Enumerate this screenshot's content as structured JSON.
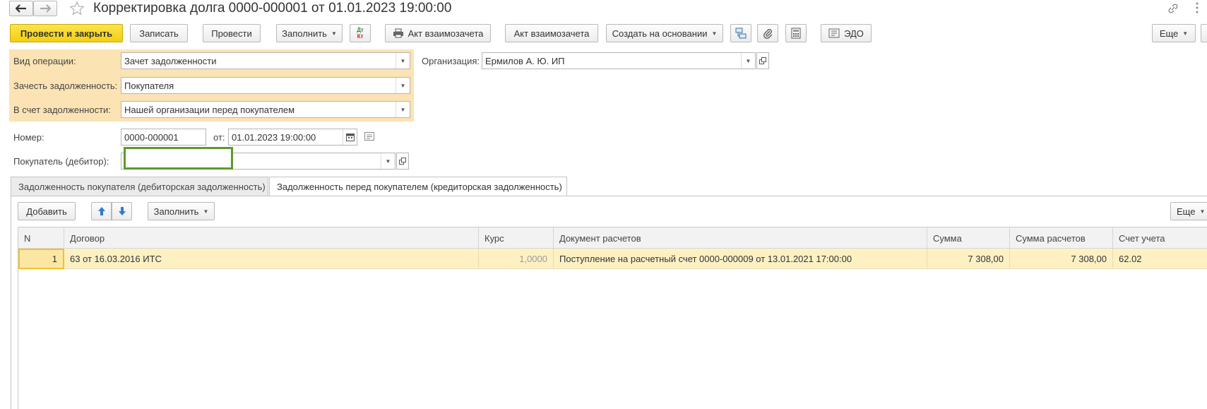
{
  "window": {
    "title": "Корректировка долга 0000-000001 от 01.01.2023 19:00:00"
  },
  "toolbar": {
    "post_and_close": "Провести и закрыть",
    "save": "Записать",
    "post": "Провести",
    "fill": "Заполнить",
    "dt_kt_line1": "Дт",
    "dt_kt_line2": "Кт",
    "print_act": "Акт взаимозачета",
    "act": "Акт взаимозачета",
    "create_based_on": "Создать на основании",
    "edo": "ЭДО",
    "more": "Еще"
  },
  "form": {
    "operation_type_label": "Вид операции:",
    "operation_type_value": "Зачет задолженности",
    "offset_debt_label": "Зачесть задолженность:",
    "offset_debt_value": "Покупателя",
    "against_debt_label": "В счет задолженности:",
    "against_debt_value": "Нашей организации перед покупателем",
    "organization_label": "Организация:",
    "organization_value": "Ермилов А. Ю. ИП",
    "number_label": "Номер:",
    "number_value": "0000-000001",
    "date_label": "от:",
    "date_value": "01.01.2023 19:00:00",
    "buyer_label": "Покупатель (дебитор):",
    "buyer_value": ""
  },
  "tabs": [
    {
      "label": "Задолженность покупателя (дебиторская задолженность)",
      "active": false
    },
    {
      "label": "Задолженность перед покупателем (кредиторская задолженность)",
      "active": true
    }
  ],
  "table_toolbar": {
    "add": "Добавить",
    "fill": "Заполнить",
    "more": "Еще"
  },
  "table": {
    "columns": [
      "N",
      "Договор",
      "Курс",
      "Документ расчетов",
      "Сумма",
      "Сумма расчетов",
      "Счет учета"
    ],
    "rows": [
      {
        "n": "1",
        "contract": "63 от 16.03.2016 ИТС",
        "rate": "1,0000",
        "document": "Поступление на расчетный счет 0000-000009 от 13.01.2021 17:00:00",
        "sum": "7 308,00",
        "settlement_sum": "7 308,00",
        "account": "62.02"
      }
    ]
  },
  "colors": {
    "primary_button": "#f3cf11",
    "highlight_panel": "#fbe3b4",
    "selected_row": "#fdf1c4",
    "focus_border": "#5b9a2f"
  }
}
